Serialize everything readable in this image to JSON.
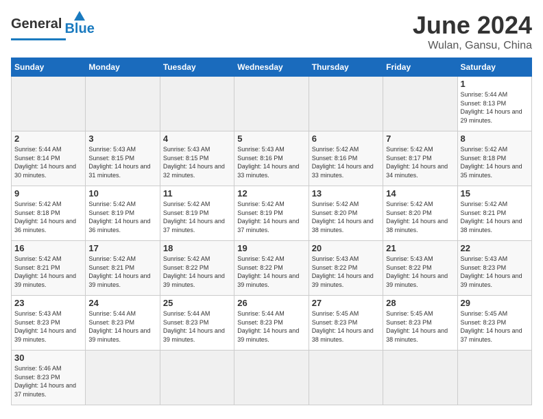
{
  "header": {
    "logo_general": "General",
    "logo_blue": "Blue",
    "month": "June 2024",
    "location": "Wulan, Gansu, China"
  },
  "weekdays": [
    "Sunday",
    "Monday",
    "Tuesday",
    "Wednesday",
    "Thursday",
    "Friday",
    "Saturday"
  ],
  "weeks": [
    [
      {
        "day": "",
        "empty": true
      },
      {
        "day": "",
        "empty": true
      },
      {
        "day": "",
        "empty": true
      },
      {
        "day": "",
        "empty": true
      },
      {
        "day": "",
        "empty": true
      },
      {
        "day": "",
        "empty": true
      },
      {
        "day": "1",
        "sunrise": "Sunrise: 5:44 AM",
        "sunset": "Sunset: 8:13 PM",
        "daylight": "Daylight: 14 hours and 29 minutes."
      }
    ],
    [
      {
        "day": "2",
        "sunrise": "Sunrise: 5:44 AM",
        "sunset": "Sunset: 8:14 PM",
        "daylight": "Daylight: 14 hours and 30 minutes."
      },
      {
        "day": "3",
        "sunrise": "Sunrise: 5:43 AM",
        "sunset": "Sunset: 8:15 PM",
        "daylight": "Daylight: 14 hours and 31 minutes."
      },
      {
        "day": "4",
        "sunrise": "Sunrise: 5:43 AM",
        "sunset": "Sunset: 8:15 PM",
        "daylight": "Daylight: 14 hours and 32 minutes."
      },
      {
        "day": "5",
        "sunrise": "Sunrise: 5:43 AM",
        "sunset": "Sunset: 8:16 PM",
        "daylight": "Daylight: 14 hours and 33 minutes."
      },
      {
        "day": "6",
        "sunrise": "Sunrise: 5:42 AM",
        "sunset": "Sunset: 8:16 PM",
        "daylight": "Daylight: 14 hours and 33 minutes."
      },
      {
        "day": "7",
        "sunrise": "Sunrise: 5:42 AM",
        "sunset": "Sunset: 8:17 PM",
        "daylight": "Daylight: 14 hours and 34 minutes."
      },
      {
        "day": "8",
        "sunrise": "Sunrise: 5:42 AM",
        "sunset": "Sunset: 8:18 PM",
        "daylight": "Daylight: 14 hours and 35 minutes."
      }
    ],
    [
      {
        "day": "9",
        "sunrise": "Sunrise: 5:42 AM",
        "sunset": "Sunset: 8:18 PM",
        "daylight": "Daylight: 14 hours and 36 minutes."
      },
      {
        "day": "10",
        "sunrise": "Sunrise: 5:42 AM",
        "sunset": "Sunset: 8:19 PM",
        "daylight": "Daylight: 14 hours and 36 minutes."
      },
      {
        "day": "11",
        "sunrise": "Sunrise: 5:42 AM",
        "sunset": "Sunset: 8:19 PM",
        "daylight": "Daylight: 14 hours and 37 minutes."
      },
      {
        "day": "12",
        "sunrise": "Sunrise: 5:42 AM",
        "sunset": "Sunset: 8:19 PM",
        "daylight": "Daylight: 14 hours and 37 minutes."
      },
      {
        "day": "13",
        "sunrise": "Sunrise: 5:42 AM",
        "sunset": "Sunset: 8:20 PM",
        "daylight": "Daylight: 14 hours and 38 minutes."
      },
      {
        "day": "14",
        "sunrise": "Sunrise: 5:42 AM",
        "sunset": "Sunset: 8:20 PM",
        "daylight": "Daylight: 14 hours and 38 minutes."
      },
      {
        "day": "15",
        "sunrise": "Sunrise: 5:42 AM",
        "sunset": "Sunset: 8:21 PM",
        "daylight": "Daylight: 14 hours and 38 minutes."
      }
    ],
    [
      {
        "day": "16",
        "sunrise": "Sunrise: 5:42 AM",
        "sunset": "Sunset: 8:21 PM",
        "daylight": "Daylight: 14 hours and 39 minutes."
      },
      {
        "day": "17",
        "sunrise": "Sunrise: 5:42 AM",
        "sunset": "Sunset: 8:21 PM",
        "daylight": "Daylight: 14 hours and 39 minutes."
      },
      {
        "day": "18",
        "sunrise": "Sunrise: 5:42 AM",
        "sunset": "Sunset: 8:22 PM",
        "daylight": "Daylight: 14 hours and 39 minutes."
      },
      {
        "day": "19",
        "sunrise": "Sunrise: 5:42 AM",
        "sunset": "Sunset: 8:22 PM",
        "daylight": "Daylight: 14 hours and 39 minutes."
      },
      {
        "day": "20",
        "sunrise": "Sunrise: 5:43 AM",
        "sunset": "Sunset: 8:22 PM",
        "daylight": "Daylight: 14 hours and 39 minutes."
      },
      {
        "day": "21",
        "sunrise": "Sunrise: 5:43 AM",
        "sunset": "Sunset: 8:22 PM",
        "daylight": "Daylight: 14 hours and 39 minutes."
      },
      {
        "day": "22",
        "sunrise": "Sunrise: 5:43 AM",
        "sunset": "Sunset: 8:23 PM",
        "daylight": "Daylight: 14 hours and 39 minutes."
      }
    ],
    [
      {
        "day": "23",
        "sunrise": "Sunrise: 5:43 AM",
        "sunset": "Sunset: 8:23 PM",
        "daylight": "Daylight: 14 hours and 39 minutes."
      },
      {
        "day": "24",
        "sunrise": "Sunrise: 5:44 AM",
        "sunset": "Sunset: 8:23 PM",
        "daylight": "Daylight: 14 hours and 39 minutes."
      },
      {
        "day": "25",
        "sunrise": "Sunrise: 5:44 AM",
        "sunset": "Sunset: 8:23 PM",
        "daylight": "Daylight: 14 hours and 39 minutes."
      },
      {
        "day": "26",
        "sunrise": "Sunrise: 5:44 AM",
        "sunset": "Sunset: 8:23 PM",
        "daylight": "Daylight: 14 hours and 39 minutes."
      },
      {
        "day": "27",
        "sunrise": "Sunrise: 5:45 AM",
        "sunset": "Sunset: 8:23 PM",
        "daylight": "Daylight: 14 hours and 38 minutes."
      },
      {
        "day": "28",
        "sunrise": "Sunrise: 5:45 AM",
        "sunset": "Sunset: 8:23 PM",
        "daylight": "Daylight: 14 hours and 38 minutes."
      },
      {
        "day": "29",
        "sunrise": "Sunrise: 5:45 AM",
        "sunset": "Sunset: 8:23 PM",
        "daylight": "Daylight: 14 hours and 37 minutes."
      }
    ],
    [
      {
        "day": "30",
        "sunrise": "Sunrise: 5:46 AM",
        "sunset": "Sunset: 8:23 PM",
        "daylight": "Daylight: 14 hours and 37 minutes."
      },
      {
        "day": "",
        "empty": true
      },
      {
        "day": "",
        "empty": true
      },
      {
        "day": "",
        "empty": true
      },
      {
        "day": "",
        "empty": true
      },
      {
        "day": "",
        "empty": true
      },
      {
        "day": "",
        "empty": true
      }
    ]
  ]
}
